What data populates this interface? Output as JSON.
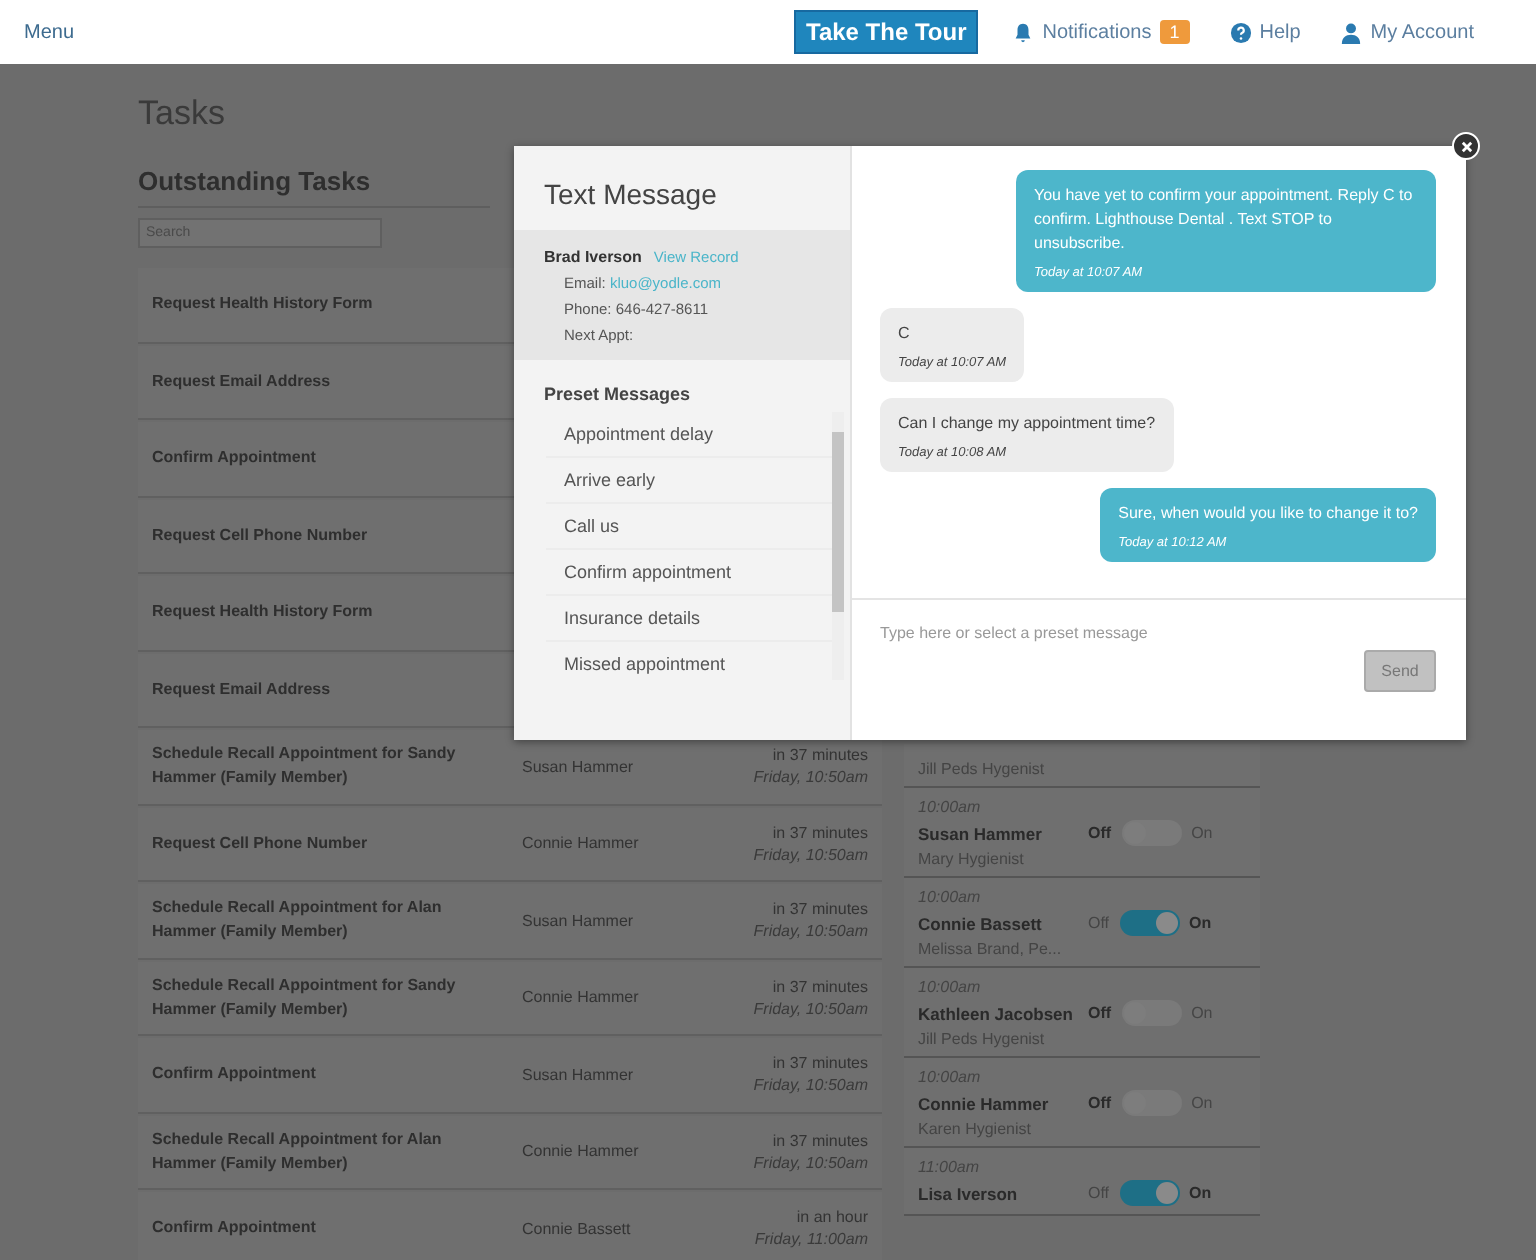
{
  "topbar": {
    "menu": "Menu",
    "tour_button": "Take The Tour",
    "notifications": "Notifications",
    "notification_count": "1",
    "help": "Help",
    "account": "My Account"
  },
  "page": {
    "title": "Tasks",
    "section": "Outstanding Tasks",
    "search": {
      "placeholder": "Search"
    }
  },
  "tasks": [
    {
      "task": "Request Health History Form"
    },
    {
      "task": "Request Email Address"
    },
    {
      "task": "Confirm Appointment"
    },
    {
      "task": "Request Cell Phone Number"
    },
    {
      "task": "Request Health History Form"
    },
    {
      "task": "Request Email Address"
    },
    {
      "task": "Schedule Recall Appointment for Sandy Hammer (Family Member)",
      "person": "Susan Hammer",
      "time": "in 37 minutes",
      "day": "Friday, 10:50am"
    },
    {
      "task": "Request Cell Phone Number",
      "person": "Connie Hammer",
      "time": "in 37 minutes",
      "day": "Friday, 10:50am"
    },
    {
      "task": "Schedule Recall Appointment for Alan Hammer (Family Member)",
      "person": "Susan Hammer",
      "time": "in 37 minutes",
      "day": "Friday, 10:50am"
    },
    {
      "task": "Schedule Recall Appointment for Sandy Hammer (Family Member)",
      "person": "Connie Hammer",
      "time": "in 37 minutes",
      "day": "Friday, 10:50am"
    },
    {
      "task": "Confirm Appointment",
      "person": "Susan Hammer",
      "time": "in 37 minutes",
      "day": "Friday, 10:50am"
    },
    {
      "task": "Schedule Recall Appointment for Alan Hammer (Family Member)",
      "person": "Connie Hammer",
      "time": "in 37 minutes",
      "day": "Friday, 10:50am"
    },
    {
      "task": "Confirm Appointment",
      "person": "Connie Bassett",
      "time": "in an hour",
      "day": "Friday, 11:00am"
    }
  ],
  "appointments_partial": {
    "provider": "Jill Peds Hygenist"
  },
  "appointments": [
    {
      "time": "10:00am",
      "name": "Susan Hammer",
      "provider": "Mary Hygienist",
      "off_label": "Off",
      "on_label": "On",
      "on": false
    },
    {
      "time": "10:00am",
      "name": "Connie Bassett",
      "provider": "Melissa Brand, Pe...",
      "off_label": "Off",
      "on_label": "On",
      "on": true
    },
    {
      "time": "10:00am",
      "name": "Kathleen Jacobsen",
      "provider": "Jill Peds Hygenist",
      "off_label": "Off",
      "on_label": "On",
      "on": false
    },
    {
      "time": "10:00am",
      "name": "Connie Hammer",
      "provider": "Karen Hygienist",
      "off_label": "Off",
      "on_label": "On",
      "on": false
    },
    {
      "time": "11:00am",
      "name": "Lisa Iverson",
      "off_label": "Off",
      "on_label": "On",
      "on": true
    }
  ],
  "modal": {
    "title": "Text Message",
    "patient": {
      "name": "Brad Iverson",
      "view_record": "View Record",
      "email_label": "Email:",
      "email": "kluo@yodle.com",
      "phone": "Phone: 646-427-8611",
      "next_appt": "Next Appt:"
    },
    "preset_heading": "Preset Messages",
    "presets": [
      "Appointment delay",
      "Arrive early",
      "Call us",
      "Confirm appointment",
      "Insurance details",
      "Missed appointment"
    ],
    "messages": [
      {
        "kind": "outgoing",
        "text": "You have yet to confirm your appointment. Reply C to confirm. Lighthouse Dental . Text STOP to unsubscribe.",
        "time": "Today at 10:07 AM"
      },
      {
        "kind": "incoming",
        "text": "C",
        "time": "Today at 10:07 AM"
      },
      {
        "kind": "incoming",
        "text": "Can I change my appointment time?",
        "time": "Today at 10:08 AM"
      },
      {
        "kind": "outgoing",
        "text": "Sure, when would you like to change it to?",
        "time": "Today at 10:12 AM"
      }
    ],
    "compose": {
      "placeholder": "Type here or select a preset message"
    },
    "send": "Send"
  }
}
